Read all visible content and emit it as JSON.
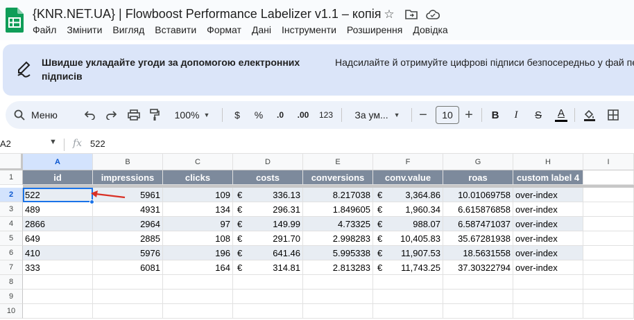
{
  "window": {
    "doc_title": "{KNR.NET.UA} | Flowboost Performance Labelizer v1.1 – копія",
    "menu": [
      "Файл",
      "Змінити",
      "Вигляд",
      "Вставити",
      "Формат",
      "Дані",
      "Інструменти",
      "Розширення",
      "Довідка"
    ]
  },
  "banner": {
    "left_text": "Швидше укладайте угоди за допомогою електронних підписів",
    "right_text": "Надсилайте й отримуйте цифрові підписи безпосередньо у фай перевагами."
  },
  "toolbar": {
    "menu_label": "Меню",
    "zoom": "100%",
    "currency": "$",
    "percent": "%",
    "dec_decrease": ".0",
    "dec_increase": ".00",
    "number_format": "123",
    "font_name": "За ум...",
    "font_size": "10",
    "bold": "B",
    "italic": "I",
    "strike": "S",
    "text_color": "A"
  },
  "formula_bar": {
    "cell_ref": "A2",
    "fx": "fx",
    "value": "522"
  },
  "columns": [
    "A",
    "B",
    "C",
    "D",
    "E",
    "F",
    "G",
    "H",
    "I"
  ],
  "row_numbers": [
    "1",
    "2",
    "3",
    "4",
    "5",
    "6",
    "7",
    "8",
    "9",
    "10"
  ],
  "table": {
    "headers": [
      "id",
      "impressions",
      "clicks",
      "costs",
      "conversions",
      "conv.value",
      "roas",
      "custom label 4"
    ],
    "currency_symbol": "€",
    "rows": [
      [
        "522",
        "5961",
        "109",
        "336.13",
        "8.217038",
        "3,364.86",
        "10.01069758",
        "over-index"
      ],
      [
        "489",
        "4931",
        "134",
        "296.31",
        "1.849605",
        "1,960.34",
        "6.615876858",
        "over-index"
      ],
      [
        "2866",
        "2964",
        "97",
        "149.99",
        "4.73325",
        "988.07",
        "6.587471037",
        "over-index"
      ],
      [
        "649",
        "2885",
        "108",
        "291.70",
        "2.998283",
        "10,405.83",
        "35.67281938",
        "over-index"
      ],
      [
        "410",
        "5976",
        "196",
        "641.46",
        "5.995338",
        "11,907.53",
        "18.5631558",
        "over-index"
      ],
      [
        "333",
        "6081",
        "164",
        "314.81",
        "2.813283",
        "11,743.25",
        "37.30322794",
        "over-index"
      ]
    ]
  },
  "colors": {
    "header_bg": "#7d8a9c",
    "alt_row": "#e8edf3",
    "selection": "#1a73e8",
    "arrow": "#d93025"
  }
}
